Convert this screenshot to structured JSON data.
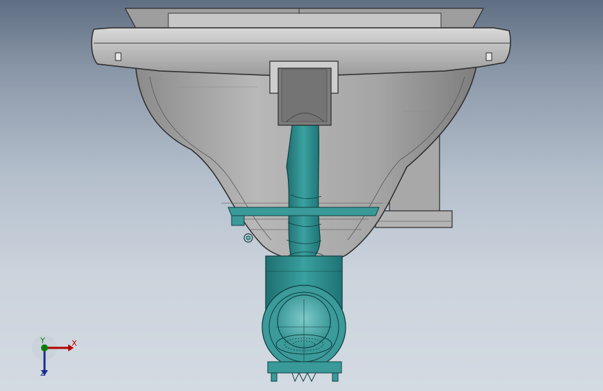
{
  "view": {
    "model_name": "pump-housing-assembly",
    "background_top": "#5f6e82",
    "background_bottom": "#d3dae2"
  },
  "colors": {
    "shell": "#a9a9a9",
    "shell_dark": "#7c7c7c",
    "shell_light": "#cfcfcf",
    "teal": "#2f8f8f",
    "teal_light": "#58b4b4",
    "edge": "#2a2a2a"
  },
  "triad": {
    "x_label": "X",
    "y_label": "Y",
    "z_label": "Z",
    "x_color": "#b30000",
    "y_color": "#0a7d0a",
    "z_color": "#1a2e8c",
    "x_icon": "x-axis-arrow-icon",
    "y_icon": "y-axis-dot-icon",
    "z_icon": "z-axis-arrow-icon"
  }
}
